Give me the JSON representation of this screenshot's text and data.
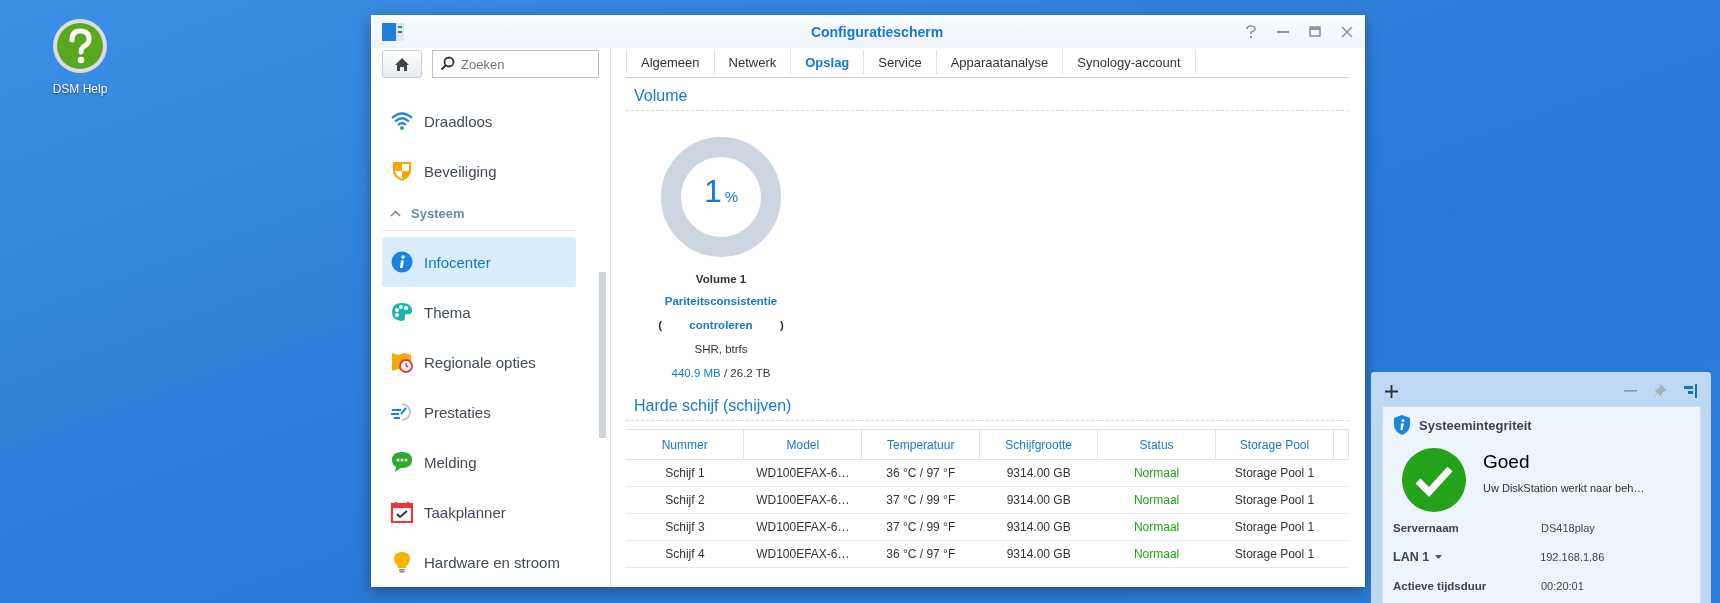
{
  "desktop_icons": [
    {
      "label": "DSM Help"
    }
  ],
  "window": {
    "title": "Configuratiescherm"
  },
  "sidebar": {
    "search": {
      "placeholder": "Zoeken"
    },
    "items": [
      {
        "kind": "item",
        "label": "Draadloos",
        "selected": false
      },
      {
        "kind": "item",
        "label": "Beveiliging",
        "selected": false
      },
      {
        "kind": "section",
        "label": "Systeem",
        "expanded": true
      },
      {
        "kind": "item",
        "label": "Infocenter",
        "selected": true
      },
      {
        "kind": "item",
        "label": "Thema",
        "selected": false
      },
      {
        "kind": "item",
        "label": "Regionale opties",
        "selected": false
      },
      {
        "kind": "item",
        "label": "Prestaties",
        "selected": false
      },
      {
        "kind": "item",
        "label": "Melding",
        "selected": false
      },
      {
        "kind": "item",
        "label": "Taakplanner",
        "selected": false
      },
      {
        "kind": "item",
        "label": "Hardware en stroom",
        "selected": false
      }
    ]
  },
  "tabs": [
    {
      "label": "Algemeen",
      "selected": false
    },
    {
      "label": "Netwerk",
      "selected": false
    },
    {
      "label": "Opslag",
      "selected": true
    },
    {
      "label": "Service",
      "selected": false
    },
    {
      "label": "Apparaatanalyse",
      "selected": false
    },
    {
      "label": "Synology-account",
      "selected": false
    }
  ],
  "volume_section": {
    "title": "Volume",
    "volumes": [
      {
        "usage_value": "1",
        "usage_unit": "%",
        "name": "Volume 1",
        "status_prefix": "(",
        "status_link": "Pariteitsconsistentie controleren",
        "status_suffix": ")",
        "type": "SHR, btrfs",
        "used": "440.9 MB",
        "total": "/ 26.2 TB"
      }
    ]
  },
  "disks_section": {
    "title": "Harde schijf (schijven)",
    "columns": [
      "Nummer",
      "Model",
      "Temperatuur",
      "Schijfgrootte",
      "Status",
      "Storage Pool"
    ],
    "rows": [
      [
        "Schijf 1",
        "WD100EFAX-6…",
        "36 °C / 97 °F",
        "9314.00 GB",
        "Normaal",
        "Storage Pool 1"
      ],
      [
        "Schijf 2",
        "WD100EFAX-6…",
        "37 °C / 99 °F",
        "9314.00 GB",
        "Normaal",
        "Storage Pool 1"
      ],
      [
        "Schijf 3",
        "WD100EFAX-6…",
        "37 °C / 99 °F",
        "9314.00 GB",
        "Normaal",
        "Storage Pool 1"
      ],
      [
        "Schijf 4",
        "WD100EFAX-6…",
        "36 °C / 97 °F",
        "9314.00 GB",
        "Normaal",
        "Storage Pool 1"
      ]
    ]
  },
  "widget": {
    "title": "Systeemintegriteit",
    "status": "Goed",
    "message": "Uw DiskStation werkt naar beh…",
    "rows": [
      {
        "kind": "plain",
        "label": "Servernaam",
        "value": "DS418play"
      },
      {
        "kind": "dropdown",
        "label": "LAN 1",
        "value": "192.168.1.86"
      },
      {
        "kind": "plain",
        "label": "Actieve tijdsduur",
        "value": "00:20:01"
      }
    ]
  }
}
